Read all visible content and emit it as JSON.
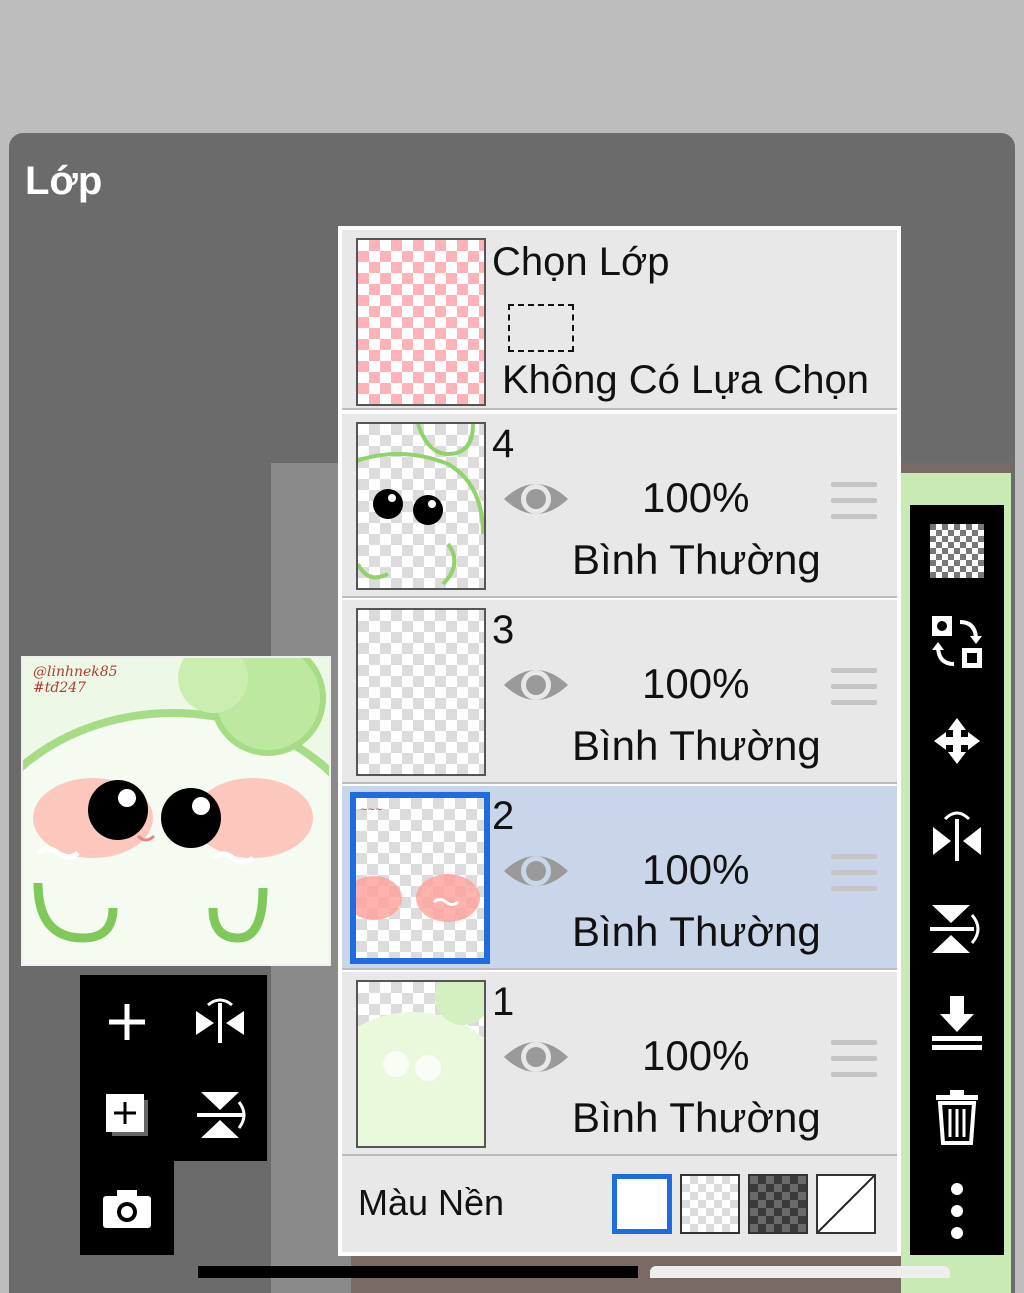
{
  "panel": {
    "title": "Lớp"
  },
  "selection": {
    "title": "Chọn Lớp",
    "subtitle": "Không Có Lựa Chọn"
  },
  "layers": [
    {
      "number": "4",
      "opacity": "100%",
      "blend_mode": "Bình Thường",
      "visible": true,
      "active": false
    },
    {
      "number": "3",
      "opacity": "100%",
      "blend_mode": "Bình Thường",
      "visible": true,
      "active": false
    },
    {
      "number": "2",
      "opacity": "100%",
      "blend_mode": "Bình Thường",
      "visible": true,
      "active": true
    },
    {
      "number": "1",
      "opacity": "100%",
      "blend_mode": "Bình Thường",
      "visible": true,
      "active": false
    }
  ],
  "background": {
    "label": "Màu Nền",
    "options": [
      "white",
      "transparent",
      "dark-checker",
      "none"
    ],
    "selected": "white"
  },
  "preview": {
    "signature": "@linhnek85 #tđ247"
  },
  "left_tools": [
    "add-layer",
    "flip-horizontal",
    "duplicate-layer",
    "flip-vertical",
    "camera-import"
  ],
  "right_tools": [
    "transparency",
    "swap-layers",
    "move",
    "flip-horizontal",
    "flip-vertical",
    "merge-down",
    "delete",
    "more"
  ],
  "colors": {
    "panel": "#6b6b6b",
    "row": "#e8e8e8",
    "active_row": "#c9d6ea",
    "accent": "#1e6de0"
  }
}
